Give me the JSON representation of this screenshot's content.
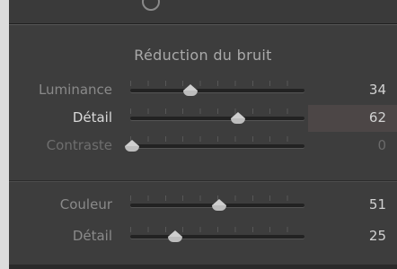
{
  "panel": {
    "title": "Réduction du bruit"
  },
  "sliders": [
    {
      "label": "Luminance",
      "value": "34",
      "fraction": 0.34
    },
    {
      "label": "Détail",
      "value": "62",
      "fraction": 0.62
    },
    {
      "label": "Contraste",
      "value": "0",
      "fraction": 0.0
    },
    {
      "label": "Couleur",
      "value": "51",
      "fraction": 0.51
    },
    {
      "label": "Détail",
      "value": "25",
      "fraction": 0.25
    }
  ],
  "colors": {
    "panel_bg": "#3d3d3d",
    "label_text": "#8a8a8a",
    "active_label": "#d9d9d9",
    "value_text": "#d2d2d2",
    "thumb": "#cfcfcf"
  }
}
